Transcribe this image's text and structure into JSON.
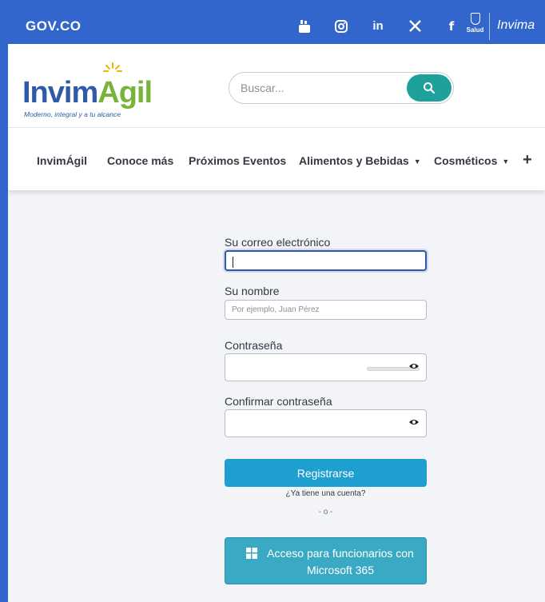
{
  "govbar": {
    "logo_text": "GOV.CO",
    "social": [
      {
        "icon": "youtube-icon",
        "glyph": "▶"
      },
      {
        "icon": "instagram-icon",
        "glyph": "◎"
      },
      {
        "icon": "linkedin-icon",
        "glyph": "in"
      },
      {
        "icon": "x-icon",
        "glyph": "X"
      },
      {
        "icon": "facebook-icon",
        "glyph": "f"
      }
    ],
    "salud_label": "Salud",
    "invima_label": "Invima"
  },
  "header": {
    "brand_part1": "Invim",
    "brand_part2": "Agil",
    "slogan": "Moderno, integral y a tu alcance",
    "search_placeholder": "Buscar..."
  },
  "nav": {
    "items": [
      {
        "label": "InvimÁgil",
        "dropdown": false
      },
      {
        "label": "Conoce más",
        "dropdown": false
      },
      {
        "label": "Próximos Eventos",
        "dropdown": false
      },
      {
        "label": "Alimentos y Bebidas",
        "dropdown": true
      },
      {
        "label": "Cosméticos",
        "dropdown": true
      }
    ],
    "more_label": "+"
  },
  "form": {
    "email_label": "Su correo electrónico",
    "email_value": "",
    "name_label": "Su nombre",
    "name_placeholder": "Por ejemplo, Juan Pérez",
    "password_label": "Contraseña",
    "confirm_label": "Confirmar contraseña",
    "submit_label": "Registrarse",
    "have_account": "¿Ya tiene una cuenta?",
    "or_text": "- o -",
    "ms_label": "Acceso para funcionarios con Microsoft 365"
  },
  "colors": {
    "gov_blue": "#3366cc",
    "brand_blue": "#2f5aa8",
    "brand_green": "#78b43c",
    "search_button": "#1fa19b",
    "primary_button": "#1f9fd0",
    "ms_button": "#3aaac4"
  }
}
